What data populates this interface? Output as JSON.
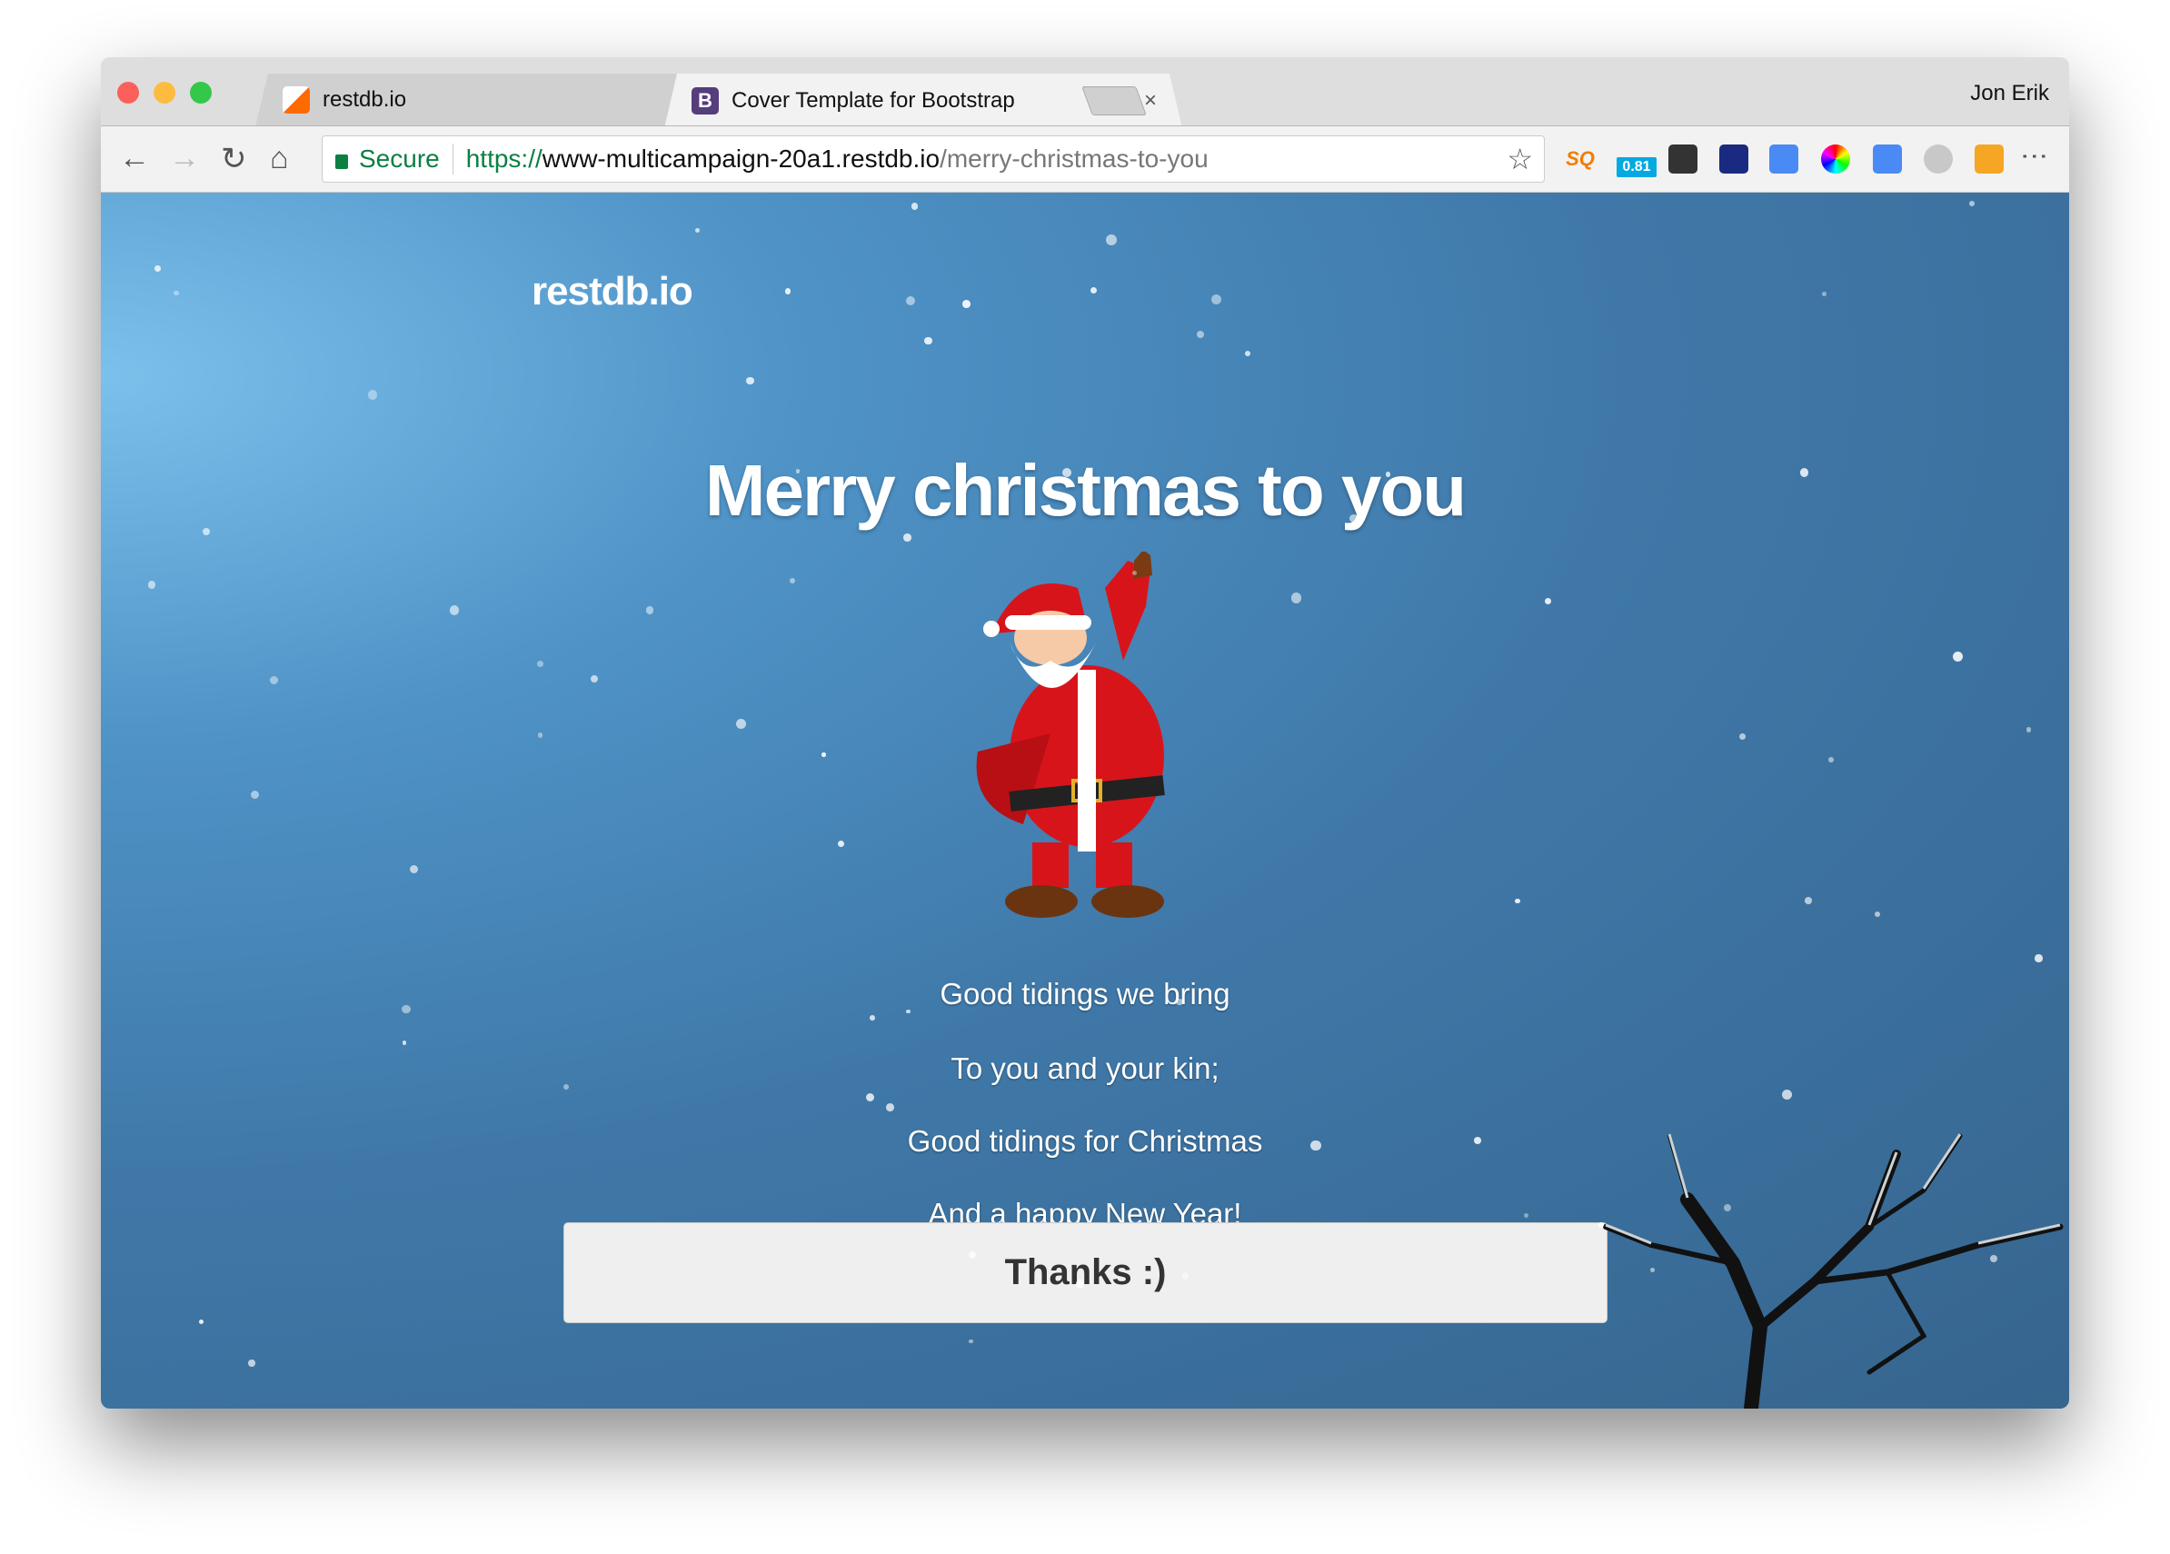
{
  "browser": {
    "tabs": [
      {
        "title": "restdb.io",
        "active": false,
        "favicon": "restdb-logo-icon"
      },
      {
        "title": "Cover Template for Bootstrap",
        "active": true,
        "favicon": "bootstrap-b-icon",
        "favicon_letter": "B"
      }
    ],
    "close_glyph": "×",
    "user": "Jon Erik",
    "secure_label": "Secure",
    "url": {
      "scheme": "https://",
      "host": "www-multicampaign-20a1.restdb.io",
      "path": "/merry-christmas-to-you"
    },
    "extensions": [
      {
        "name": "sq-extension-icon",
        "label": "SQ",
        "color": "#f57c00"
      },
      {
        "name": "rate-badge-extension-icon",
        "label": "0.81",
        "color": "#03a9e0"
      },
      {
        "name": "evernote-icon",
        "color": "#333333"
      },
      {
        "name": "speedometer-icon",
        "color": "#1a2a80"
      },
      {
        "name": "google-translate-icon",
        "color": "#4a8af4"
      },
      {
        "name": "color-picker-icon",
        "color": "#e53935"
      },
      {
        "name": "tag-extension-icon",
        "color": "#4a8af4"
      },
      {
        "name": "u-extension-icon",
        "color": "#c8c8c8"
      },
      {
        "name": "share-extension-icon",
        "color": "#f5a623"
      }
    ]
  },
  "page": {
    "brand": "restdb.io",
    "title": "Merry christmas to you",
    "lines": [
      "Good tidings we bring",
      "To you and your kin;",
      "Good tidings for Christmas",
      "And a happy New Year!"
    ],
    "button": "Thanks :)"
  }
}
